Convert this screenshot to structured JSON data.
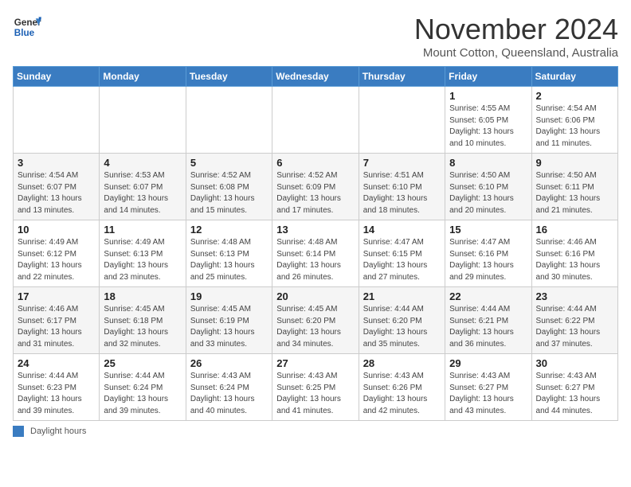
{
  "header": {
    "logo_line1": "General",
    "logo_line2": "Blue",
    "month_title": "November 2024",
    "subtitle": "Mount Cotton, Queensland, Australia"
  },
  "days_of_week": [
    "Sunday",
    "Monday",
    "Tuesday",
    "Wednesday",
    "Thursday",
    "Friday",
    "Saturday"
  ],
  "footer": {
    "color_label": "Daylight hours"
  },
  "weeks": [
    {
      "days": [
        {
          "num": "",
          "info": ""
        },
        {
          "num": "",
          "info": ""
        },
        {
          "num": "",
          "info": ""
        },
        {
          "num": "",
          "info": ""
        },
        {
          "num": "",
          "info": ""
        },
        {
          "num": "1",
          "info": "Sunrise: 4:55 AM\nSunset: 6:05 PM\nDaylight: 13 hours\nand 10 minutes."
        },
        {
          "num": "2",
          "info": "Sunrise: 4:54 AM\nSunset: 6:06 PM\nDaylight: 13 hours\nand 11 minutes."
        }
      ]
    },
    {
      "days": [
        {
          "num": "3",
          "info": "Sunrise: 4:54 AM\nSunset: 6:07 PM\nDaylight: 13 hours\nand 13 minutes."
        },
        {
          "num": "4",
          "info": "Sunrise: 4:53 AM\nSunset: 6:07 PM\nDaylight: 13 hours\nand 14 minutes."
        },
        {
          "num": "5",
          "info": "Sunrise: 4:52 AM\nSunset: 6:08 PM\nDaylight: 13 hours\nand 15 minutes."
        },
        {
          "num": "6",
          "info": "Sunrise: 4:52 AM\nSunset: 6:09 PM\nDaylight: 13 hours\nand 17 minutes."
        },
        {
          "num": "7",
          "info": "Sunrise: 4:51 AM\nSunset: 6:10 PM\nDaylight: 13 hours\nand 18 minutes."
        },
        {
          "num": "8",
          "info": "Sunrise: 4:50 AM\nSunset: 6:10 PM\nDaylight: 13 hours\nand 20 minutes."
        },
        {
          "num": "9",
          "info": "Sunrise: 4:50 AM\nSunset: 6:11 PM\nDaylight: 13 hours\nand 21 minutes."
        }
      ]
    },
    {
      "days": [
        {
          "num": "10",
          "info": "Sunrise: 4:49 AM\nSunset: 6:12 PM\nDaylight: 13 hours\nand 22 minutes."
        },
        {
          "num": "11",
          "info": "Sunrise: 4:49 AM\nSunset: 6:13 PM\nDaylight: 13 hours\nand 23 minutes."
        },
        {
          "num": "12",
          "info": "Sunrise: 4:48 AM\nSunset: 6:13 PM\nDaylight: 13 hours\nand 25 minutes."
        },
        {
          "num": "13",
          "info": "Sunrise: 4:48 AM\nSunset: 6:14 PM\nDaylight: 13 hours\nand 26 minutes."
        },
        {
          "num": "14",
          "info": "Sunrise: 4:47 AM\nSunset: 6:15 PM\nDaylight: 13 hours\nand 27 minutes."
        },
        {
          "num": "15",
          "info": "Sunrise: 4:47 AM\nSunset: 6:16 PM\nDaylight: 13 hours\nand 29 minutes."
        },
        {
          "num": "16",
          "info": "Sunrise: 4:46 AM\nSunset: 6:16 PM\nDaylight: 13 hours\nand 30 minutes."
        }
      ]
    },
    {
      "days": [
        {
          "num": "17",
          "info": "Sunrise: 4:46 AM\nSunset: 6:17 PM\nDaylight: 13 hours\nand 31 minutes."
        },
        {
          "num": "18",
          "info": "Sunrise: 4:45 AM\nSunset: 6:18 PM\nDaylight: 13 hours\nand 32 minutes."
        },
        {
          "num": "19",
          "info": "Sunrise: 4:45 AM\nSunset: 6:19 PM\nDaylight: 13 hours\nand 33 minutes."
        },
        {
          "num": "20",
          "info": "Sunrise: 4:45 AM\nSunset: 6:20 PM\nDaylight: 13 hours\nand 34 minutes."
        },
        {
          "num": "21",
          "info": "Sunrise: 4:44 AM\nSunset: 6:20 PM\nDaylight: 13 hours\nand 35 minutes."
        },
        {
          "num": "22",
          "info": "Sunrise: 4:44 AM\nSunset: 6:21 PM\nDaylight: 13 hours\nand 36 minutes."
        },
        {
          "num": "23",
          "info": "Sunrise: 4:44 AM\nSunset: 6:22 PM\nDaylight: 13 hours\nand 37 minutes."
        }
      ]
    },
    {
      "days": [
        {
          "num": "24",
          "info": "Sunrise: 4:44 AM\nSunset: 6:23 PM\nDaylight: 13 hours\nand 39 minutes."
        },
        {
          "num": "25",
          "info": "Sunrise: 4:44 AM\nSunset: 6:24 PM\nDaylight: 13 hours\nand 39 minutes."
        },
        {
          "num": "26",
          "info": "Sunrise: 4:43 AM\nSunset: 6:24 PM\nDaylight: 13 hours\nand 40 minutes."
        },
        {
          "num": "27",
          "info": "Sunrise: 4:43 AM\nSunset: 6:25 PM\nDaylight: 13 hours\nand 41 minutes."
        },
        {
          "num": "28",
          "info": "Sunrise: 4:43 AM\nSunset: 6:26 PM\nDaylight: 13 hours\nand 42 minutes."
        },
        {
          "num": "29",
          "info": "Sunrise: 4:43 AM\nSunset: 6:27 PM\nDaylight: 13 hours\nand 43 minutes."
        },
        {
          "num": "30",
          "info": "Sunrise: 4:43 AM\nSunset: 6:27 PM\nDaylight: 13 hours\nand 44 minutes."
        }
      ]
    }
  ]
}
